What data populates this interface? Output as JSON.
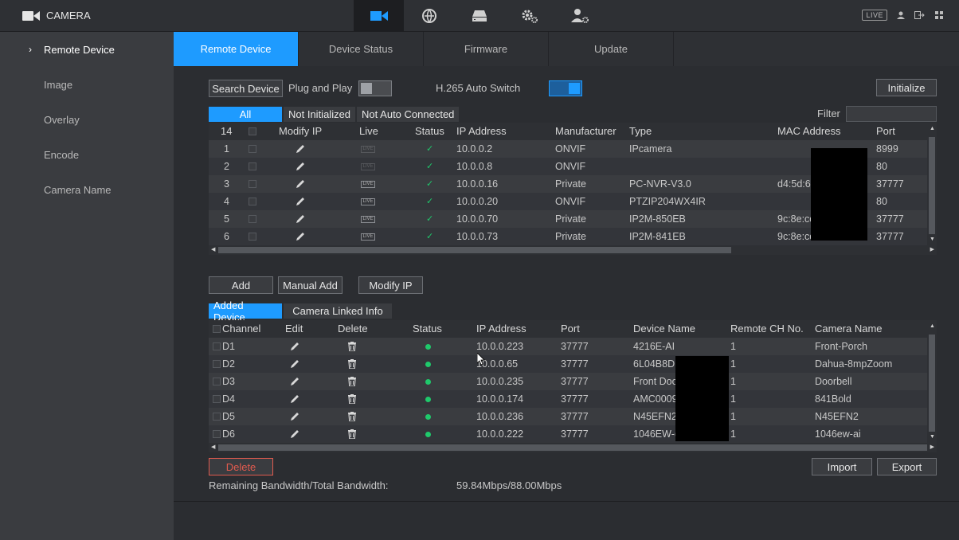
{
  "app": {
    "title": "CAMERA"
  },
  "topnav": {
    "items": [
      {
        "icon": "camera-icon",
        "active": true
      },
      {
        "icon": "network-icon",
        "active": false
      },
      {
        "icon": "storage-icon",
        "active": false
      },
      {
        "icon": "settings-icon",
        "active": false
      },
      {
        "icon": "account-icon",
        "active": false
      }
    ],
    "live_label": "LIVE"
  },
  "sidebar": {
    "items": [
      {
        "label": "Remote Device",
        "active": true
      },
      {
        "label": "Image",
        "active": false
      },
      {
        "label": "Overlay",
        "active": false
      },
      {
        "label": "Encode",
        "active": false
      },
      {
        "label": "Camera Name",
        "active": false
      }
    ]
  },
  "tabs": [
    {
      "label": "Remote Device",
      "active": true
    },
    {
      "label": "Device Status",
      "active": false
    },
    {
      "label": "Firmware",
      "active": false
    },
    {
      "label": "Update",
      "active": false
    }
  ],
  "toolbar": {
    "search_label": "Search Device",
    "plug_play_label": "Plug and Play",
    "plug_play_on": false,
    "h265_label": "H.265 Auto Switch",
    "h265_on": true,
    "initialize_label": "Initialize"
  },
  "filter_tabs": [
    "All",
    "Not Initialized",
    "Not Auto Connected"
  ],
  "filter": {
    "label": "Filter",
    "value": ""
  },
  "search_table": {
    "count": "14",
    "headers": [
      "Modify IP",
      "Live",
      "Status",
      "IP Address",
      "Manufacturer",
      "Type",
      "MAC Address",
      "Port"
    ],
    "rows": [
      {
        "no": "1",
        "ip": "10.0.0.2",
        "manufacturer": "ONVIF",
        "type": "IPcamera",
        "mac": "",
        "port": "8999",
        "live_active": false
      },
      {
        "no": "2",
        "ip": "10.0.0.8",
        "manufacturer": "ONVIF",
        "type": "",
        "mac": "",
        "port": "80",
        "live_active": false
      },
      {
        "no": "3",
        "ip": "10.0.0.16",
        "manufacturer": "Private",
        "type": "PC-NVR-V3.0",
        "mac": "d4:5d:6",
        "port": "37777",
        "live_active": true
      },
      {
        "no": "4",
        "ip": "10.0.0.20",
        "manufacturer": "ONVIF",
        "type": "PTZIP204WX4IR",
        "mac": "",
        "port": "80",
        "live_active": true
      },
      {
        "no": "5",
        "ip": "10.0.0.70",
        "manufacturer": "Private",
        "type": "IP2M-850EB",
        "mac": "9c:8e:cc",
        "port": "37777",
        "live_active": true
      },
      {
        "no": "6",
        "ip": "10.0.0.73",
        "manufacturer": "Private",
        "type": "IP2M-841EB",
        "mac": "9c:8e:cc",
        "port": "37777",
        "live_active": true
      }
    ]
  },
  "actions": {
    "add_label": "Add",
    "manual_add_label": "Manual Add",
    "modify_ip_label": "Modify IP"
  },
  "added_tabs": [
    "Added Device",
    "Camera Linked Info"
  ],
  "added_table": {
    "headers": [
      "Channel",
      "Edit",
      "Delete",
      "Status",
      "IP Address",
      "Port",
      "Device Name",
      "Remote CH No.",
      "Camera Name"
    ],
    "rows": [
      {
        "channel": "D1",
        "ip": "10.0.0.223",
        "port": "37777",
        "device": "4216E-AI",
        "remote_ch": "1",
        "camera": "Front-Porch"
      },
      {
        "channel": "D2",
        "ip": "10.0.0.65",
        "port": "37777",
        "device": "6L04B8D",
        "remote_ch": "1",
        "camera": "Dahua-8mpZoom"
      },
      {
        "channel": "D3",
        "ip": "10.0.0.235",
        "port": "37777",
        "device": "Front Doo",
        "remote_ch": "1",
        "camera": "Doorbell"
      },
      {
        "channel": "D4",
        "ip": "10.0.0.174",
        "port": "37777",
        "device": "AMC0009",
        "remote_ch": "1",
        "camera": "841Bold"
      },
      {
        "channel": "D5",
        "ip": "10.0.0.236",
        "port": "37777",
        "device": "N45EFN2",
        "remote_ch": "1",
        "camera": "N45EFN2"
      },
      {
        "channel": "D6",
        "ip": "10.0.0.222",
        "port": "37777",
        "device": "1046EW-(",
        "remote_ch": "1",
        "camera": "1046ew-ai"
      }
    ]
  },
  "footer": {
    "delete_label": "Delete",
    "import_label": "Import",
    "export_label": "Export",
    "bandwidth_label": "Remaining Bandwidth/Total Bandwidth:",
    "bandwidth_value": "59.84Mbps/88.00Mbps"
  },
  "colors": {
    "accent": "#1e9bff",
    "ok": "#1fc96b",
    "danger": "#e05a4e"
  }
}
